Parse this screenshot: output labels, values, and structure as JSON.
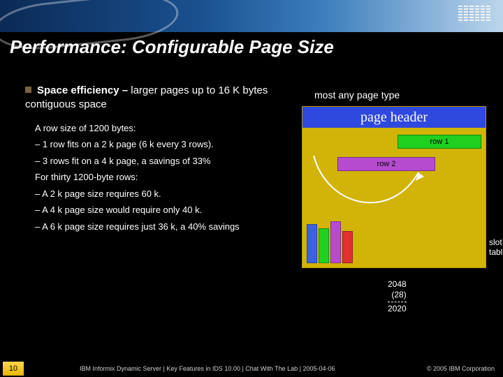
{
  "brand": "IBM",
  "title": "Performance: Configurable Page Size",
  "headline_lead": "Space efficiency –",
  "headline_rest": " larger pages up to 16 K bytes contiguous space",
  "line_rowsize": "A row size of 1200 bytes:",
  "line_fit1": "– 1 row fits on a 2 k page (6 k every 3 rows).",
  "line_fit2": "– 3 rows fit on a 4 k page, a savings of 33%",
  "line_thirty": "For thirty 1200-byte rows:",
  "line_2k": "– A 2 k page size requires 60 k.",
  "line_4k": "– A 4 k page size would require only 40 k.",
  "line_6k": "– A 6 k page size requires just 36 k, a 40% savings",
  "diagram_caption": "most any page type",
  "page_header_label": "page header",
  "row1_label": "row 1",
  "row2_label": "row 2",
  "slot_table_label1": "slot",
  "slot_table_label2": "table",
  "calc_a": "2048",
  "calc_b": "(28)",
  "calc_result": "2020",
  "page_number": "10",
  "footer_text": "IBM Informix Dynamic Server  |  Key Features in IDS 10.00  |  Chat With The Lab  |  2005-04-06",
  "copyright": "© 2005 IBM Corporation"
}
